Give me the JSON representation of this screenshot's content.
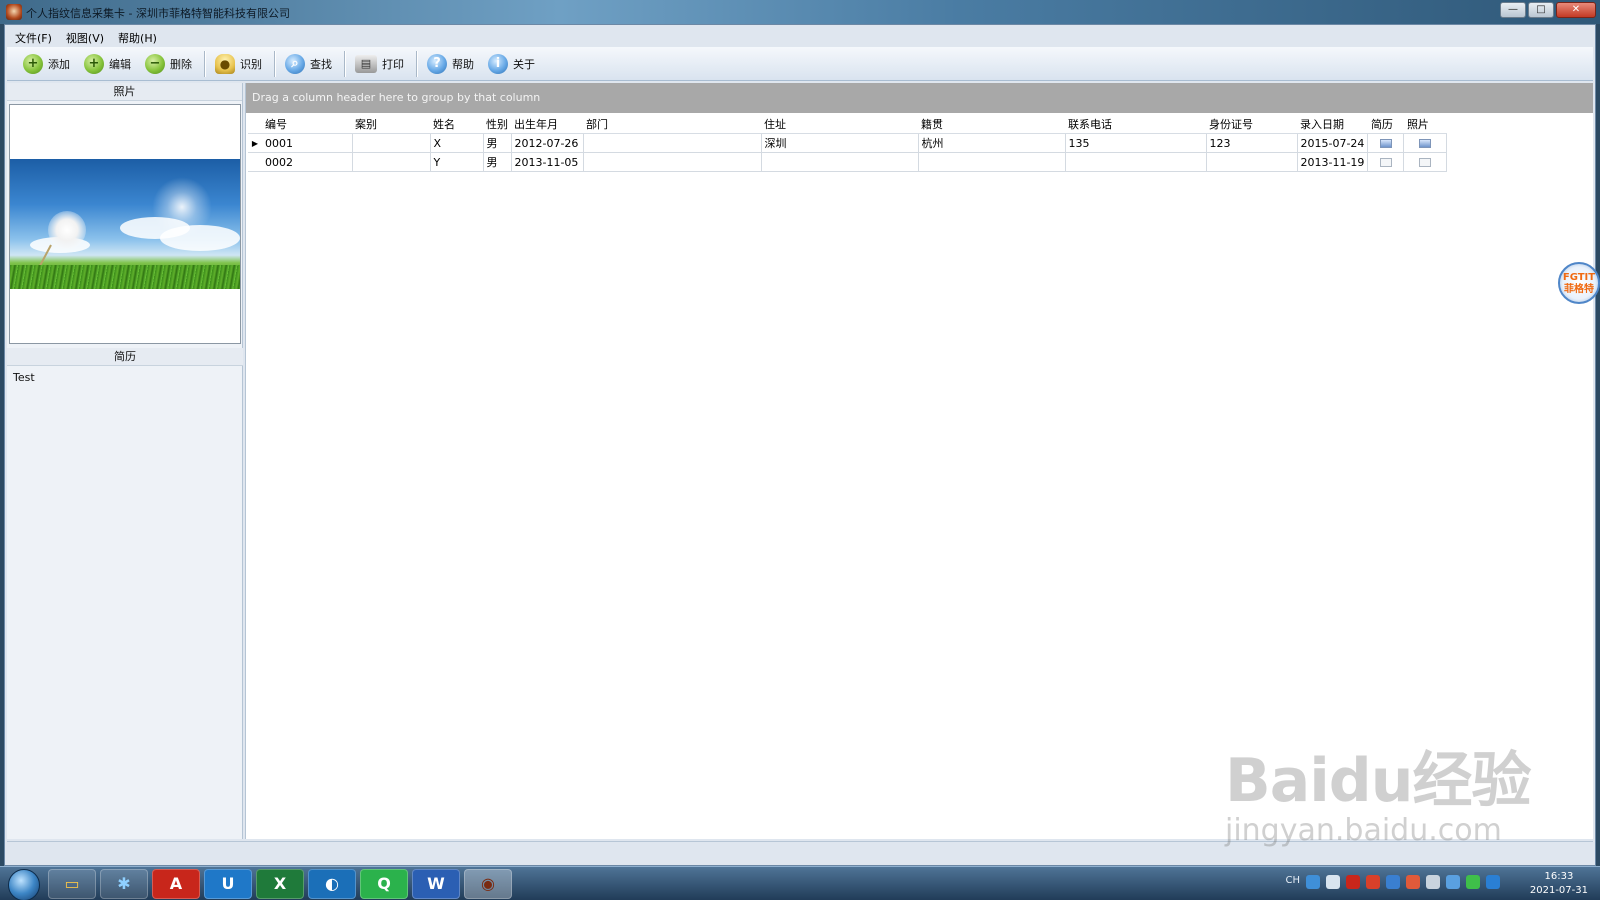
{
  "window": {
    "title": "个人指纹信息采集卡 - 深圳市菲格特智能科技有限公司",
    "controls": [
      "—",
      "□",
      "✕"
    ]
  },
  "menu": [
    {
      "label": "文件(F)"
    },
    {
      "label": "视图(V)"
    },
    {
      "label": "帮助(H)"
    }
  ],
  "toolbar": {
    "add": "添加",
    "edit": "编辑",
    "delete": "删除",
    "identify": "识别",
    "find": "查找",
    "print": "打印",
    "help": "帮助",
    "about": "关于"
  },
  "left_panel": {
    "photo_header": "照片",
    "resume_header": "简历",
    "resume_text": "Test"
  },
  "grid": {
    "group_hint": "Drag a column header here to group by that column",
    "columns": [
      "编号",
      "案别",
      "姓名",
      "性别",
      "出生年月",
      "部门",
      "住址",
      "籍贯",
      "联系电话",
      "身份证号",
      "录入日期",
      "简历",
      "照片"
    ],
    "rows": [
      {
        "id": "0001",
        "case": "",
        "name": "X",
        "gender": "男",
        "birth": "2012-07-26",
        "dept": "",
        "address": "深圳",
        "native": "杭州",
        "phone": "135",
        "idcard": "123",
        "entry_date": "2015-07-24",
        "selected": true
      },
      {
        "id": "0002",
        "case": "",
        "name": "Y",
        "gender": "男",
        "birth": "2013-11-05",
        "dept": "",
        "address": "",
        "native": "",
        "phone": "",
        "idcard": "",
        "entry_date": "2013-11-19",
        "selected": false
      }
    ]
  },
  "float_badge": {
    "line1": "FGTIT",
    "line2": "菲格特"
  },
  "watermark": {
    "main": "Baidu经验",
    "sub": "jingyan.baidu.com"
  },
  "taskbar": {
    "items": [
      "explorer",
      "pin-app",
      "acrobat",
      "blue-app",
      "excel",
      "browser",
      "q-app",
      "word",
      "fingerprint-app"
    ],
    "tray_lang": "CH",
    "time": "16:33",
    "date": "2021-07-31"
  }
}
